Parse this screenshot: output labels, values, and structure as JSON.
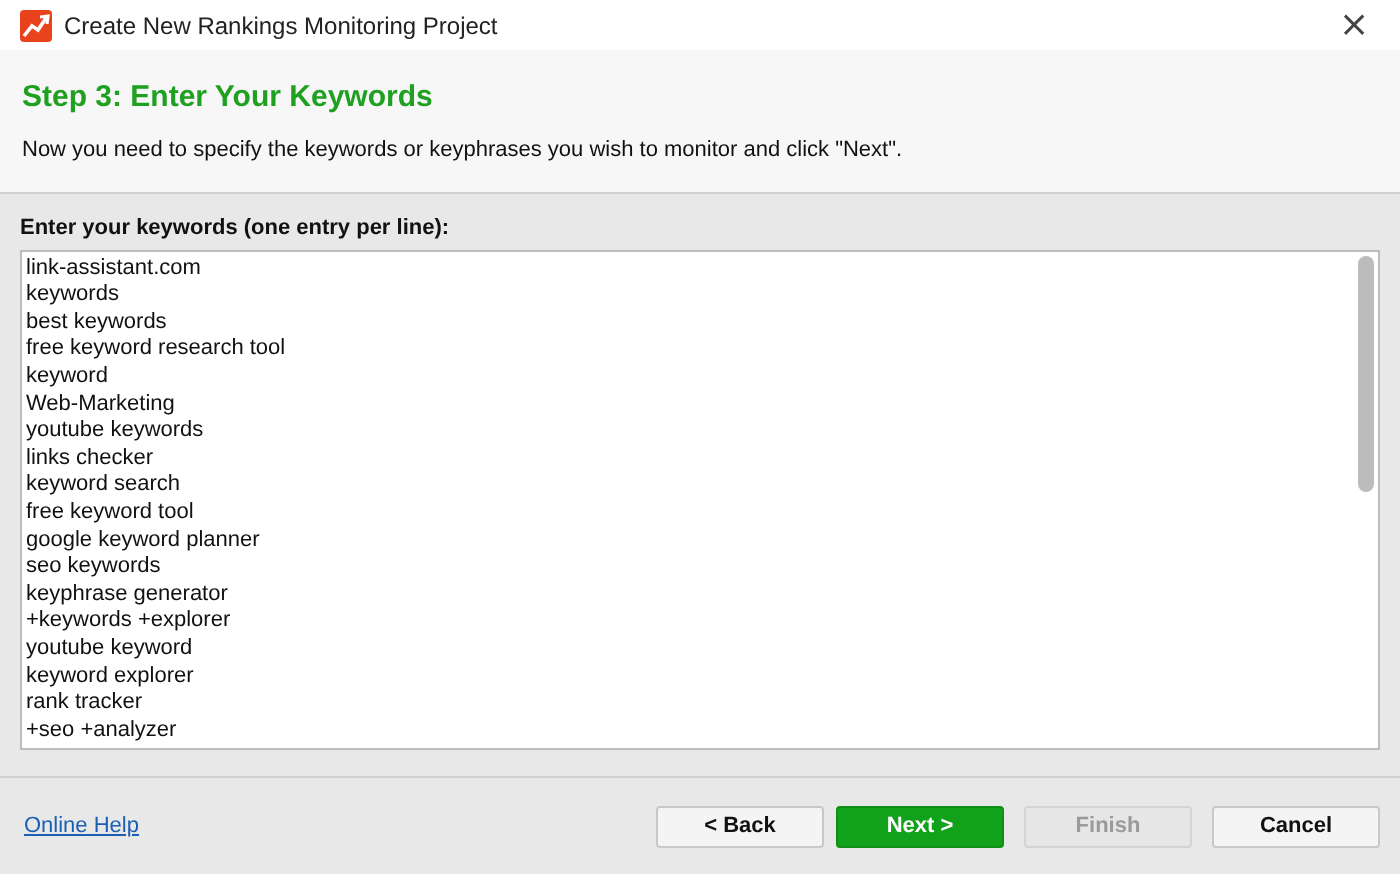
{
  "window": {
    "title": "Create New Rankings Monitoring Project",
    "close": "×"
  },
  "header": {
    "step_title": "Step 3: Enter Your Keywords",
    "instruction": "Now you need to specify the keywords or keyphrases you wish to monitor and click \"Next\"."
  },
  "keywords": {
    "label": "Enter your keywords (one entry per line):",
    "entries": [
      "link-assistant.com",
      "keywords",
      "best keywords",
      "free keyword research tool",
      "keyword",
      "Web-Marketing",
      "youtube keywords",
      "links checker",
      "keyword search",
      "free keyword tool",
      "google keyword planner",
      "seo keywords",
      "keyphrase generator",
      "+keywords +explorer",
      "youtube keyword",
      "keyword explorer",
      "rank tracker",
      "+seo +analyzer"
    ]
  },
  "footer": {
    "help_link": "Online Help",
    "buttons": [
      {
        "label": "< Back",
        "kind": "default",
        "disabled": false
      },
      {
        "label": "Next >",
        "kind": "primary",
        "disabled": false
      },
      {
        "label": "Finish",
        "kind": "default",
        "disabled": true
      },
      {
        "label": "Cancel",
        "kind": "default",
        "disabled": false
      }
    ]
  }
}
